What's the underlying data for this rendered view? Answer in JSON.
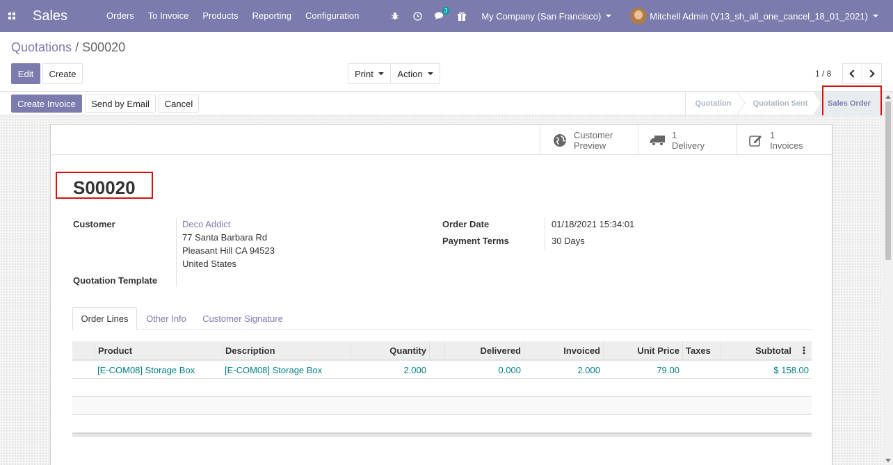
{
  "navbar": {
    "app_name": "Sales",
    "menu": [
      "Orders",
      "To Invoice",
      "Products",
      "Reporting",
      "Configuration"
    ],
    "messages_badge": "3",
    "company": "My Company (San Francisco)",
    "user": "Mitchell Admin (V13_sh_all_one_cancel_18_01_2021)",
    "color": "#7c7bad"
  },
  "breadcrumb": {
    "parent": "Quotations",
    "separator": " / ",
    "current": "S00020"
  },
  "control": {
    "edit": "Edit",
    "create": "Create",
    "print": "Print",
    "action": "Action",
    "pager": "1 / 8"
  },
  "statusbar": {
    "buttons": [
      "Create Invoice",
      "Send by Email",
      "Cancel"
    ],
    "stages": [
      "Quotation",
      "Quotation Sent",
      "Sales Order"
    ],
    "active_stage": "Sales Order"
  },
  "smart_buttons": [
    {
      "icon": "globe-icon",
      "line1": "Customer",
      "line2": "Preview"
    },
    {
      "icon": "truck-icon",
      "line1": "1",
      "line2": "Delivery"
    },
    {
      "icon": "pencil-square-icon",
      "line1": "1",
      "line2": "Invoices"
    }
  ],
  "order": {
    "name": "S00020",
    "customer_label": "Customer",
    "customer_name": "Deco Addict",
    "address": [
      "77 Santa Barbara Rd",
      "Pleasant Hill CA 94523",
      "United States"
    ],
    "template_label": "Quotation Template",
    "order_date_label": "Order Date",
    "order_date": "01/18/2021 15:34:01",
    "payment_terms_label": "Payment Terms",
    "payment_terms": "30 Days"
  },
  "tabs": [
    "Order Lines",
    "Other Info",
    "Customer Signature"
  ],
  "lines": {
    "columns": [
      "Product",
      "Description",
      "Quantity",
      "Delivered",
      "Invoiced",
      "Unit Price",
      "Taxes",
      "Subtotal"
    ],
    "rows": [
      {
        "product": "[E-COM08] Storage Box",
        "description": "[E-COM08] Storage Box",
        "quantity": "2.000",
        "delivered": "0.000",
        "invoiced": "2.000",
        "unit_price": "79.00",
        "taxes": "",
        "subtotal": "$ 158.00"
      }
    ]
  }
}
